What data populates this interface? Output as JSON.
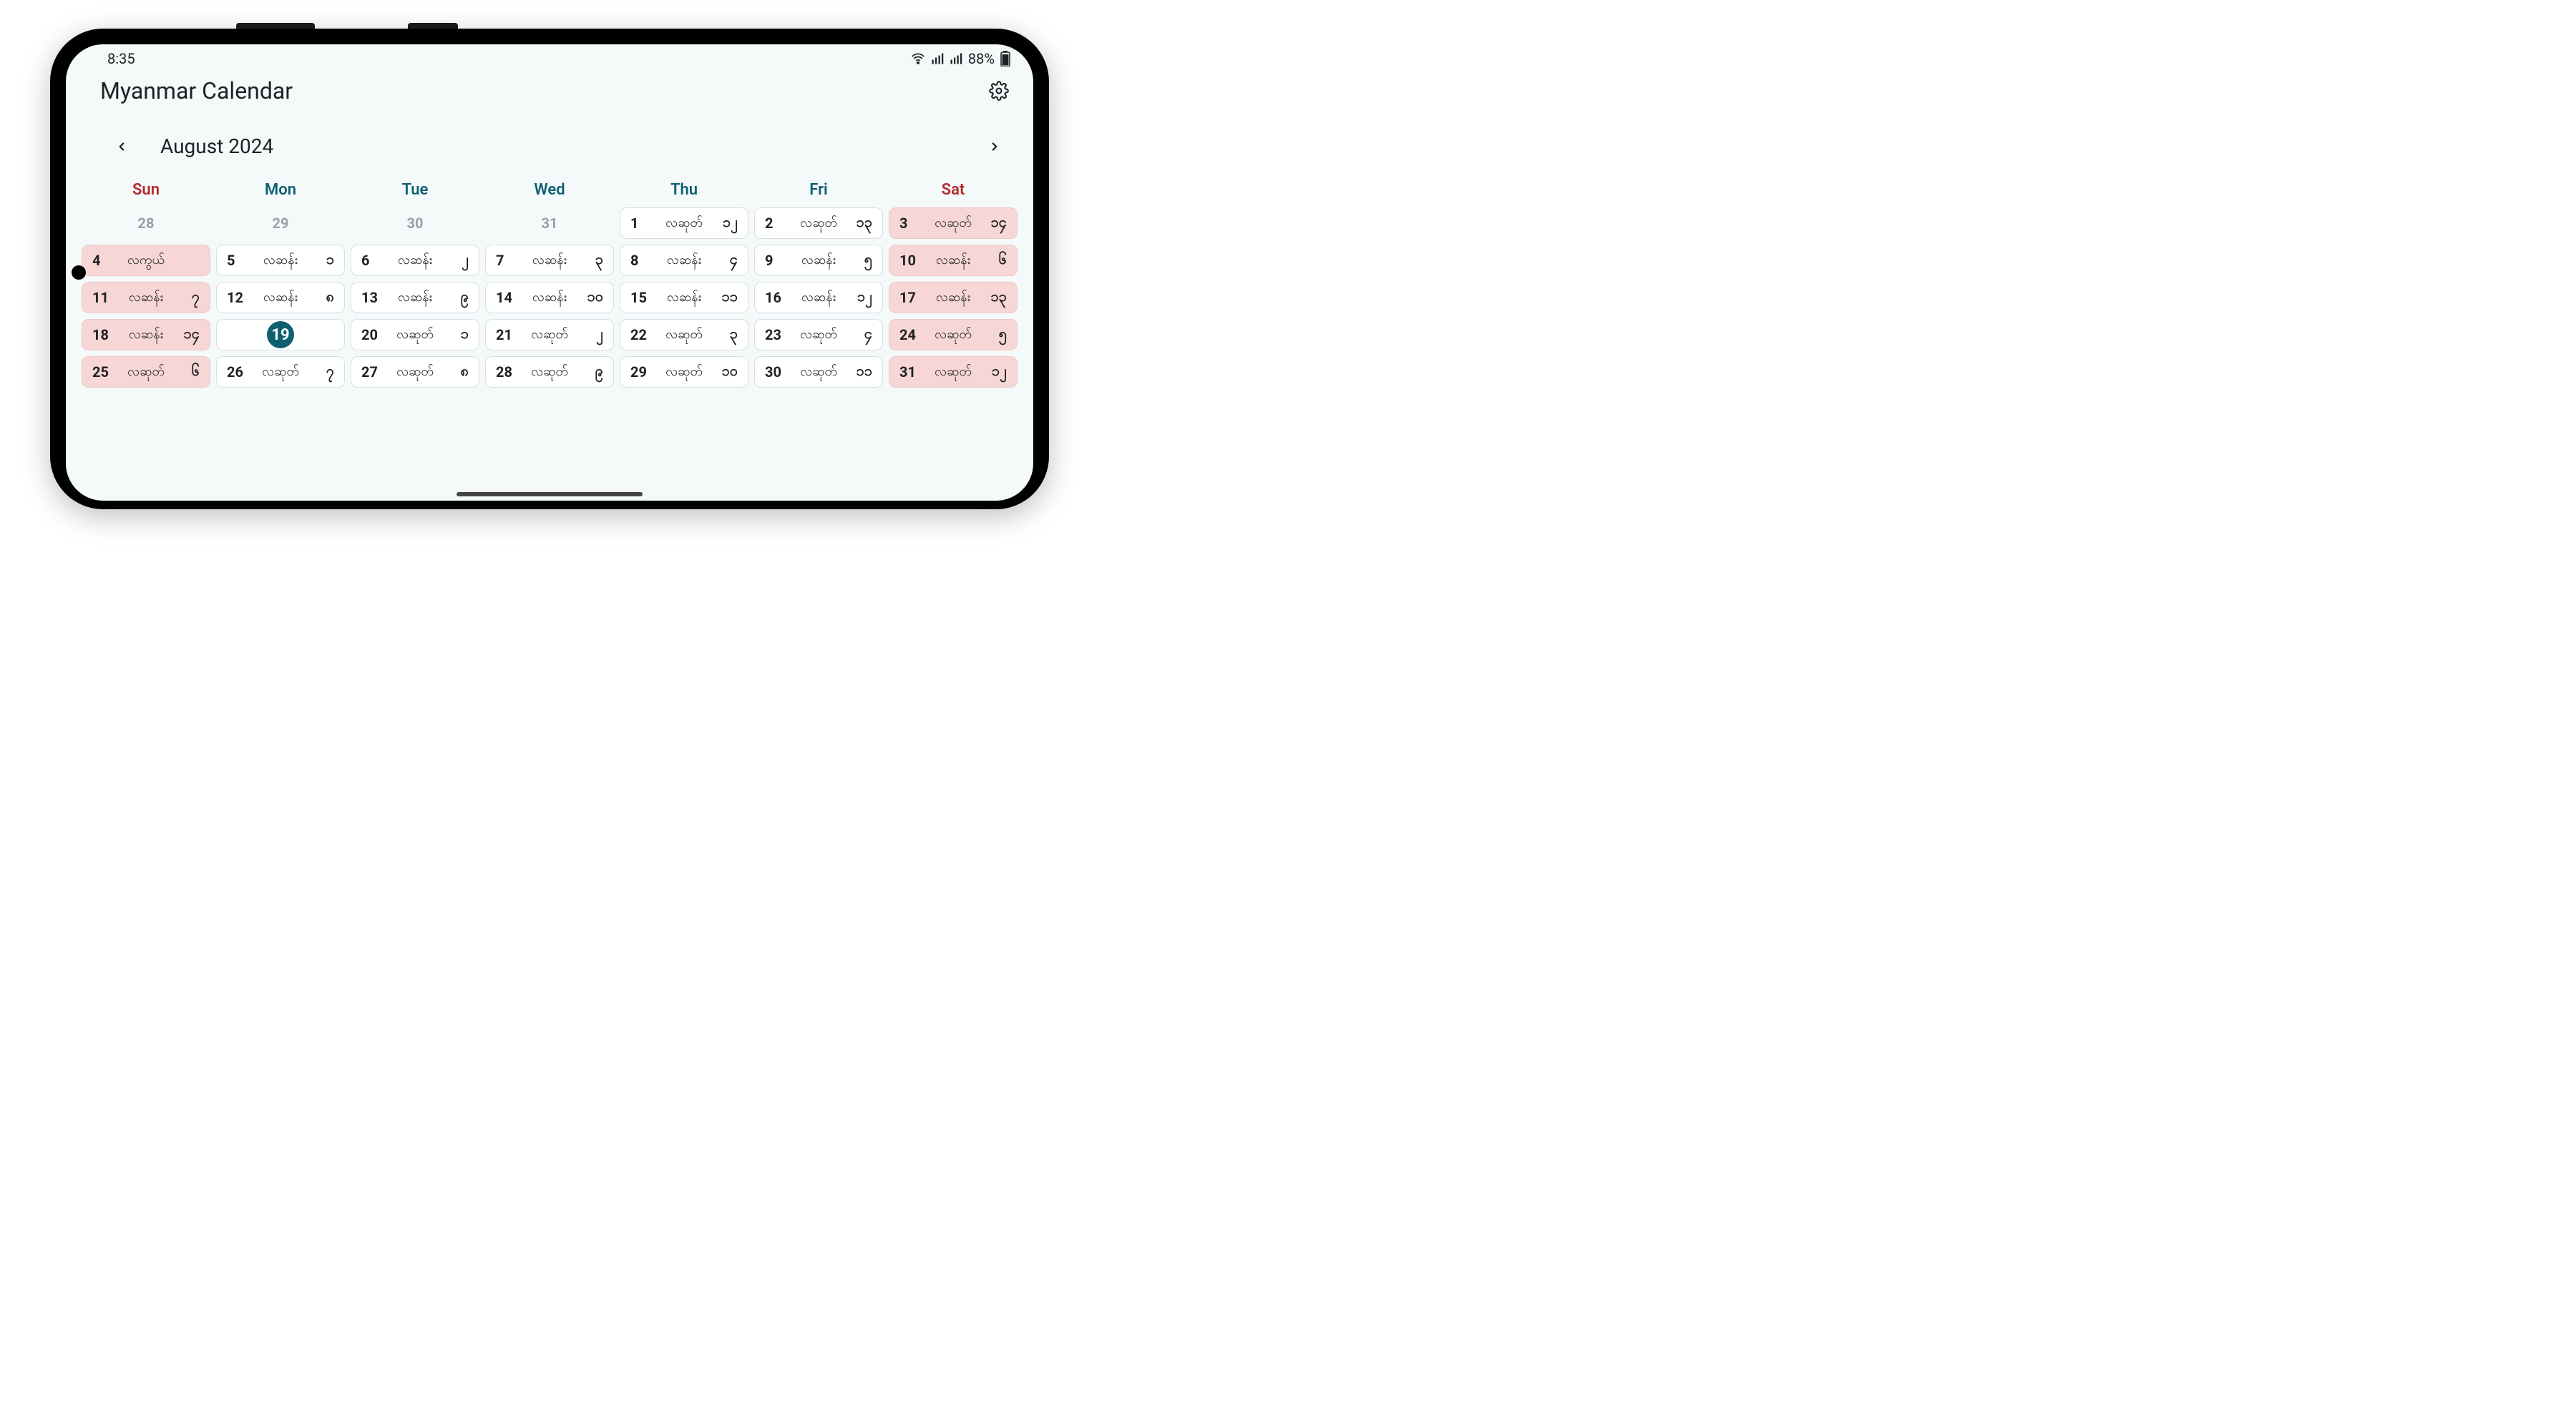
{
  "statusbar": {
    "time": "8:35",
    "battery_pct": "88%"
  },
  "appbar": {
    "title": "Myanmar Calendar"
  },
  "monthnav": {
    "label": "August 2024"
  },
  "colors": {
    "accent": "#0e6070",
    "danger": "#b3282d",
    "cell_weekend_bg": "#f7d7d6"
  },
  "calendar": {
    "dow": [
      "Sun",
      "Mon",
      "Tue",
      "Wed",
      "Thu",
      "Fri",
      "Sat"
    ],
    "weeks": [
      [
        {
          "g": "28",
          "outside": true
        },
        {
          "g": "29",
          "outside": true
        },
        {
          "g": "30",
          "outside": true
        },
        {
          "g": "31",
          "outside": true
        },
        {
          "g": "1",
          "phase": "လဆုတ်",
          "md": "၁၂"
        },
        {
          "g": "2",
          "phase": "လဆုတ်",
          "md": "၁၃"
        },
        {
          "g": "3",
          "phase": "လဆုတ်",
          "md": "၁၄",
          "weekend": true
        }
      ],
      [
        {
          "g": "4",
          "phase": "လကွယ်",
          "md": "",
          "weekend": true
        },
        {
          "g": "5",
          "phase": "လဆန်း",
          "md": "၁"
        },
        {
          "g": "6",
          "phase": "လဆန်း",
          "md": "၂"
        },
        {
          "g": "7",
          "phase": "လဆန်း",
          "md": "၃"
        },
        {
          "g": "8",
          "phase": "လဆန်း",
          "md": "၄"
        },
        {
          "g": "9",
          "phase": "လဆန်း",
          "md": "၅"
        },
        {
          "g": "10",
          "phase": "လဆန်း",
          "md": "၆",
          "weekend": true
        }
      ],
      [
        {
          "g": "11",
          "phase": "လဆန်း",
          "md": "၇",
          "weekend": true
        },
        {
          "g": "12",
          "phase": "လဆန်း",
          "md": "၈"
        },
        {
          "g": "13",
          "phase": "လဆန်း",
          "md": "၉"
        },
        {
          "g": "14",
          "phase": "လဆန်း",
          "md": "၁၀"
        },
        {
          "g": "15",
          "phase": "လဆန်း",
          "md": "၁၁"
        },
        {
          "g": "16",
          "phase": "လဆန်း",
          "md": "၁၂"
        },
        {
          "g": "17",
          "phase": "လဆန်း",
          "md": "၁၃",
          "weekend": true
        }
      ],
      [
        {
          "g": "18",
          "phase": "လဆန်း",
          "md": "၁၄",
          "weekend": true
        },
        {
          "g": "19",
          "today": true
        },
        {
          "g": "20",
          "phase": "လဆုတ်",
          "md": "၁"
        },
        {
          "g": "21",
          "phase": "လဆုတ်",
          "md": "၂"
        },
        {
          "g": "22",
          "phase": "လဆုတ်",
          "md": "၃"
        },
        {
          "g": "23",
          "phase": "လဆုတ်",
          "md": "၄"
        },
        {
          "g": "24",
          "phase": "လဆုတ်",
          "md": "၅",
          "weekend": true
        }
      ],
      [
        {
          "g": "25",
          "phase": "လဆုတ်",
          "md": "၆",
          "weekend": true
        },
        {
          "g": "26",
          "phase": "လဆုတ်",
          "md": "၇"
        },
        {
          "g": "27",
          "phase": "လဆုတ်",
          "md": "၈"
        },
        {
          "g": "28",
          "phase": "လဆုတ်",
          "md": "၉"
        },
        {
          "g": "29",
          "phase": "လဆုတ်",
          "md": "၁၀"
        },
        {
          "g": "30",
          "phase": "လဆုတ်",
          "md": "၁၁"
        },
        {
          "g": "31",
          "phase": "လဆုတ်",
          "md": "၁၂",
          "weekend": true
        }
      ]
    ]
  }
}
